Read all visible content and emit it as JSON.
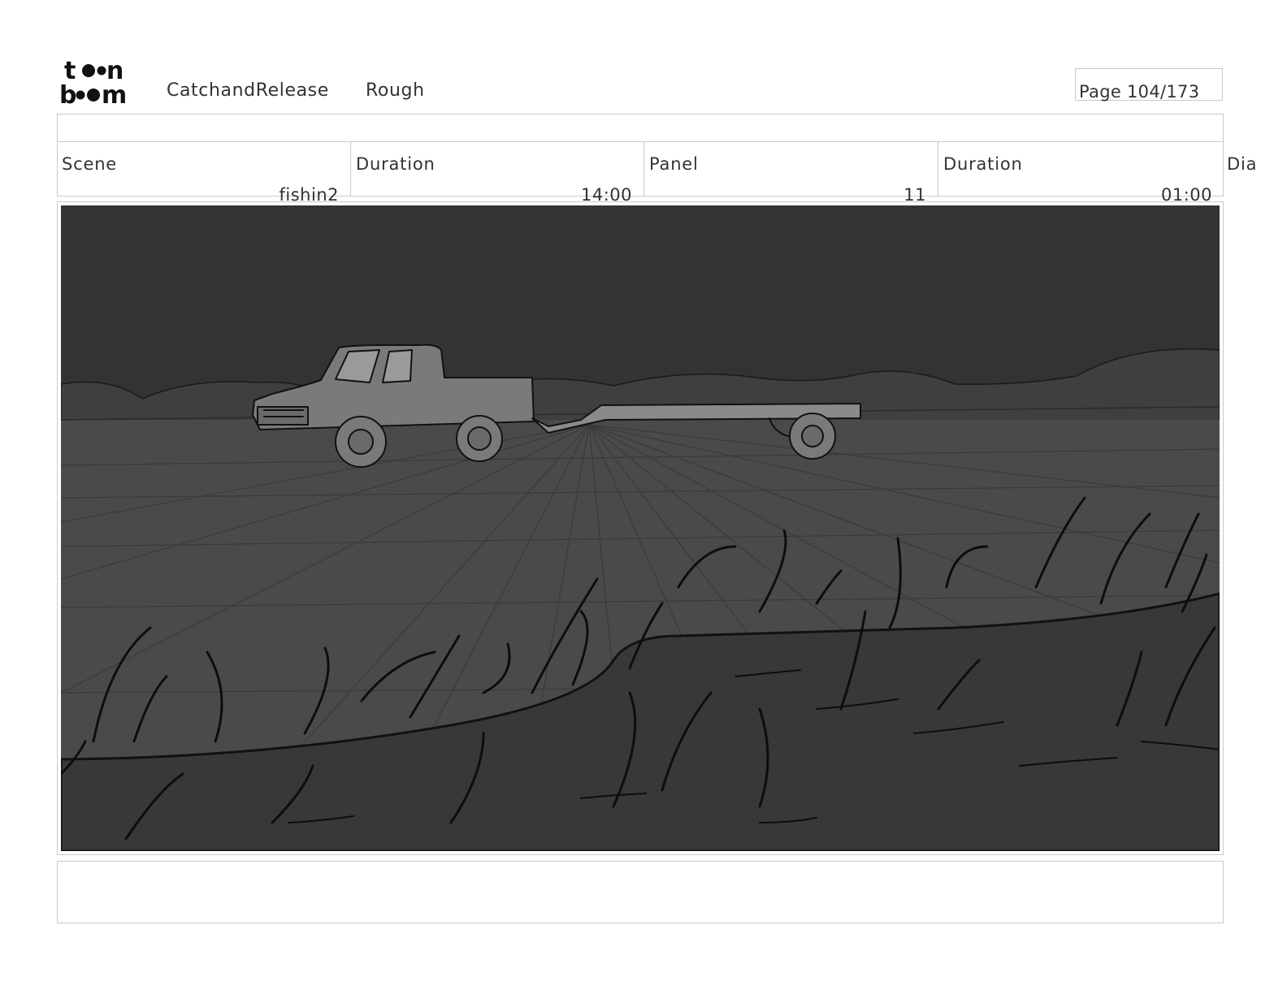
{
  "header": {
    "logo_text": "toon boom",
    "project": "CatchandRelease",
    "stage": "Rough",
    "page": "Page 104/173"
  },
  "info": {
    "scene_label": "Scene",
    "scene_value": "fishin2",
    "scene_duration_label": "Duration",
    "scene_duration_value": "14:00",
    "panel_label": "Panel",
    "panel_value": "11",
    "panel_duration_label": "Duration",
    "panel_duration_value": "01:00",
    "dialogue_label": "Dia"
  },
  "artwork": {
    "subject": "pickup-truck-towing-trailer-on-lake-with-reeds",
    "colors": {
      "sky": "#333333",
      "hills": "#3f3f3f",
      "water": "#4a4a4a",
      "near_water": "#383838",
      "truck": "#7a7a7a",
      "line": "#111111"
    }
  }
}
